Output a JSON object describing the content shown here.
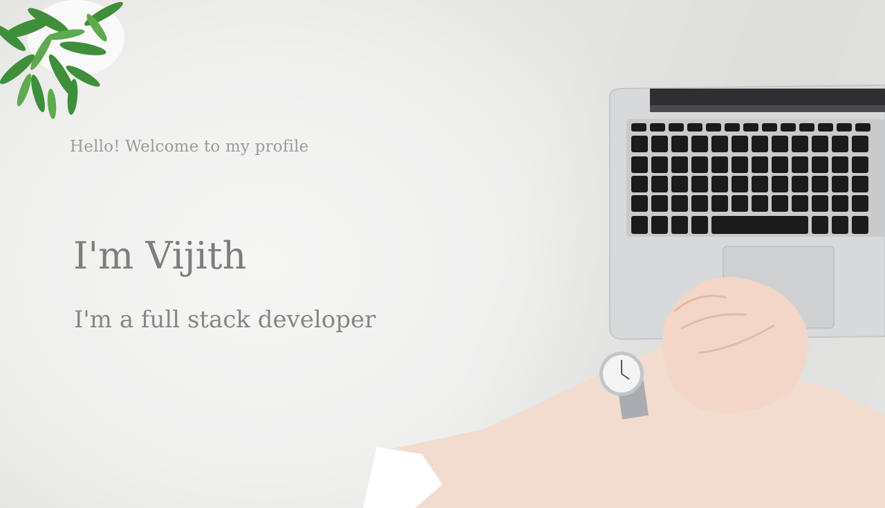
{
  "hero": {
    "greeting": "Hello! Welcome to my profile",
    "name": "I'm Vijith",
    "role": "I'm a full stack developer"
  },
  "icons": [
    "plant-icon",
    "laptop-icon",
    "hands-icon",
    "watch-icon"
  ],
  "colors": {
    "background": "#efefed",
    "text": "#7e7e7e",
    "greeting_text": "#9b9b9b",
    "laptop": "#d6d7d9",
    "keys": "#1b1b1b",
    "plant": "#3f8f3a",
    "skin": "#f2d6c8"
  }
}
